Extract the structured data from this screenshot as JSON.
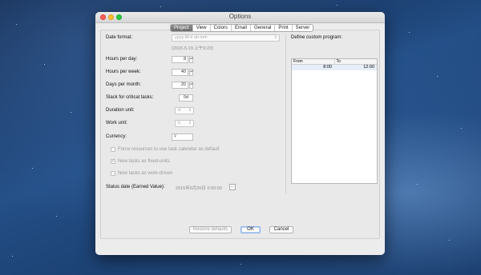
{
  "window": {
    "title": "Options"
  },
  "tabs": [
    "Project",
    "View",
    "Colors",
    "Email",
    "General",
    "Print",
    "Server"
  ],
  "active_tab": "Project",
  "project": {
    "date_format_label": "Date format:",
    "date_format_placeholder": "yyyy-M-d ah:mm",
    "date_format_example": "(2015-5-19 上午9:23)",
    "hours_per_day_label": "Hours per day:",
    "hours_per_day": "8",
    "hours_per_week_label": "Hours per week:",
    "hours_per_week": "40",
    "days_per_month_label": "Days per month:",
    "days_per_month": "20",
    "slack_label": "Slack for critical tasks:",
    "slack": "0d",
    "duration_unit_label": "Duration unit:",
    "duration_unit": "d",
    "work_unit_label": "Work unit:",
    "work_unit": "h",
    "currency_label": "Currency:",
    "currency": "¥",
    "force_calendar_label": "Force resources to use task calendar as default",
    "fixed_units_label": "New tasks as fixed-units",
    "work_driven_label": "New tasks as work-driven",
    "status_date_label": "Status date (Earned Value):",
    "status_date": "2015年5月20日 0:00:00",
    "status_date_button": "..."
  },
  "custom_program": {
    "label": "Define custom program:",
    "headers": [
      "From",
      "To"
    ],
    "rows": [
      {
        "from": "8:00",
        "to": "12:00"
      }
    ]
  },
  "buttons": {
    "restore": "Restore defaults",
    "ok": "OK",
    "cancel": "Cancel"
  },
  "glyphs": {
    "spin": "▴▾",
    "combo": "⇕",
    "check": "✓",
    "dropdown": "▾"
  }
}
